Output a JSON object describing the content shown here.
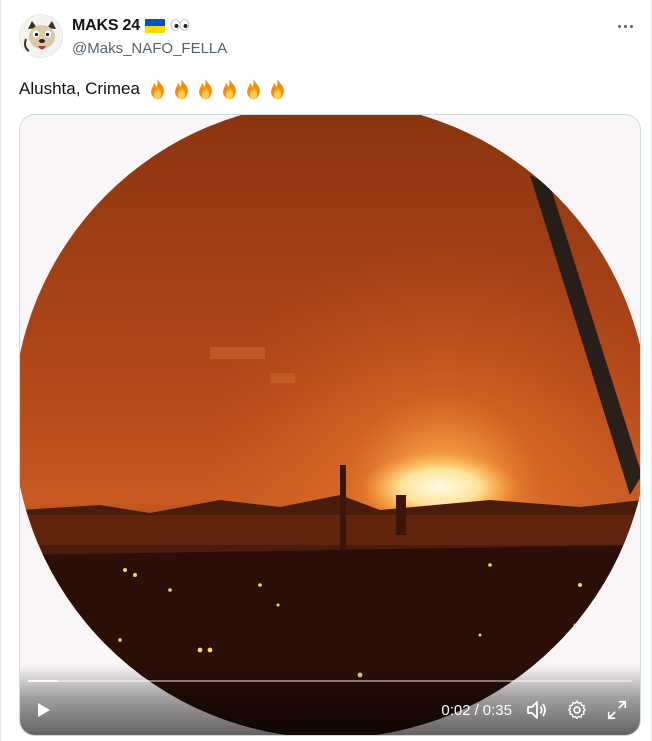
{
  "author": {
    "display_name": "MAKS 24",
    "handle": "@Maks_NAFO_FELLA",
    "name_emojis": [
      "flag-ukraine-icon",
      "eyes-icon"
    ]
  },
  "tweet": {
    "text": "Alushta, Crimea",
    "emojis": [
      "fire-icon",
      "fire-icon",
      "fire-icon",
      "fire-icon",
      "fire-icon",
      "fire-icon"
    ]
  },
  "video": {
    "current_time": "0:02",
    "separator": "/",
    "duration": "0:35",
    "progress": 0.05
  },
  "colors": {
    "text_primary": "#0f1419",
    "text_secondary": "#536471",
    "border": "#cfd9de"
  }
}
